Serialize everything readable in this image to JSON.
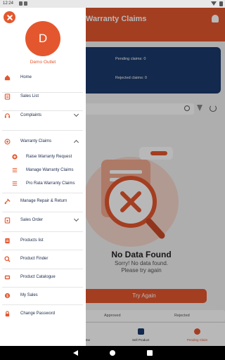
{
  "status_bar": {
    "time": "12:24"
  },
  "app": {
    "title": "Warranty Claims",
    "summary": {
      "pending": "Pending claims: 0",
      "rejected": "Rejected claims: 0"
    },
    "empty_state": {
      "title": "No Data Found",
      "line1": "Sorry! No data found.",
      "line2": "Please try again"
    },
    "try_again_label": "Try Again",
    "status_tabs": [
      "Approved",
      "Rejected"
    ],
    "bottom_nav": [
      "Home",
      "Sell Product",
      "Pending Claim"
    ]
  },
  "drawer": {
    "avatar_initial": "D",
    "outlet_name": "Demo Outlet",
    "menu": {
      "home": "Home",
      "sales_list": "Sales List",
      "complaints": "Complaints",
      "warranty_claims": "Warranty Claims",
      "raise_warranty": "Raise Warranty Request",
      "manage_warranty": "Manage Warranty Claims",
      "pro_rata": "Pro Rata Warranty Claims",
      "repair_return": "Manage Repair & Return",
      "sales_order": "Sales Order",
      "products_list": "Products list",
      "product_finder": "Product Finder",
      "product_catalogue": "Product Catalogue",
      "my_sales": "My Sales",
      "change_password": "Change Password"
    }
  },
  "colors": {
    "accent": "#e4572e",
    "navy": "#1b3a6b",
    "text": "#1b2a4a"
  }
}
